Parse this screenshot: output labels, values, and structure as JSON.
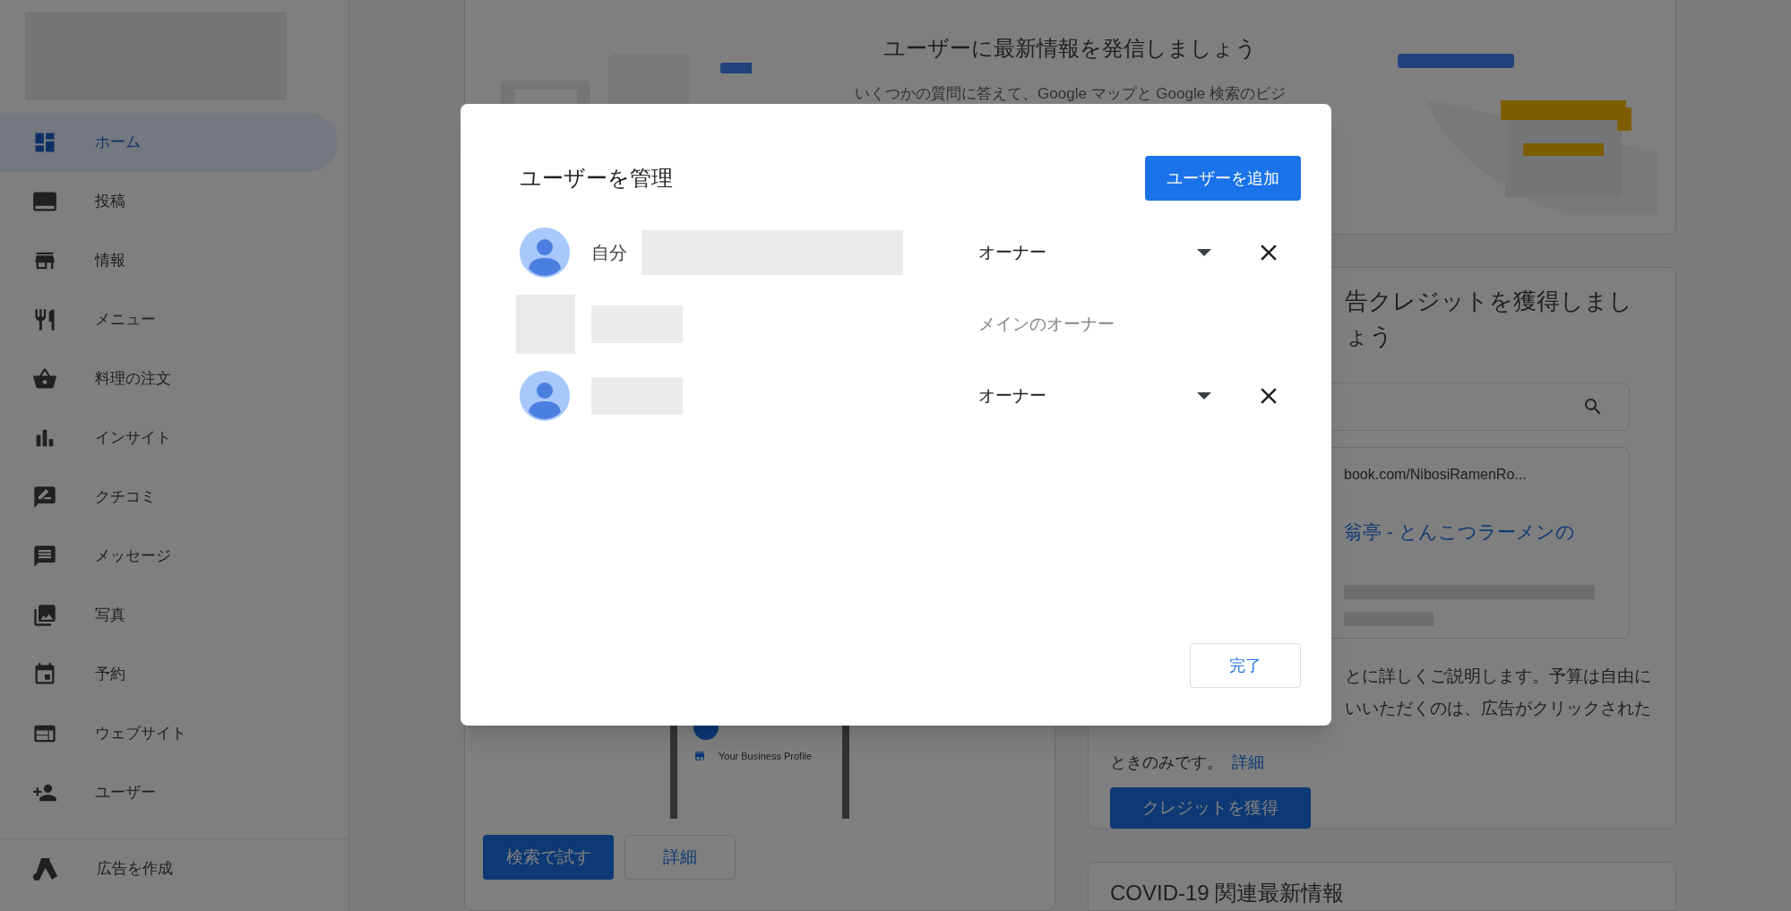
{
  "sidebar": {
    "items": [
      {
        "label": "ホーム",
        "selected": true
      },
      {
        "label": "投稿",
        "selected": false
      },
      {
        "label": "情報",
        "selected": false
      },
      {
        "label": "メニュー",
        "selected": false
      },
      {
        "label": "料理の注文",
        "selected": false
      },
      {
        "label": "インサイト",
        "selected": false
      },
      {
        "label": "クチコミ",
        "selected": false
      },
      {
        "label": "メッセージ",
        "selected": false
      },
      {
        "label": "写真",
        "selected": false
      },
      {
        "label": "予約",
        "selected": false
      },
      {
        "label": "ウェブサイト",
        "selected": false
      },
      {
        "label": "ユーザー",
        "selected": false
      }
    ],
    "footer_item": {
      "label": "広告を作成"
    }
  },
  "updates_card": {
    "title": "ユーザーに最新情報を発信しましょう",
    "description": "いくつかの質問に答えて、Google マップと Google 検索のビジ"
  },
  "try_card": {
    "preview_label": "Your Business Profile",
    "buttons": [
      {
        "label": "検索で試す",
        "kind": "primary"
      },
      {
        "label": "詳細",
        "kind": "outlined"
      }
    ]
  },
  "credit_card": {
    "title": "告クレジットを獲得しましょう",
    "ad_preview": {
      "url": "book.com/NibosiRamenRo...",
      "headline": "翁亭 - とんこつラーメンの"
    },
    "description_lines": [
      "とに詳しくご説明します。予算は自由に",
      "いいただくのは、広告がクリックされた"
    ],
    "description_end": "ときのみです。",
    "learn_more": "詳細",
    "button": "クレジットを獲得"
  },
  "covid_card": {
    "title": "COVID-19 関連最新情報"
  },
  "dialog": {
    "title": "ユーザーを管理",
    "add_button": "ユーザーを追加",
    "users": [
      {
        "kind": "editable",
        "self_label": "自分",
        "role": "オーナー"
      },
      {
        "kind": "fixed",
        "role": "メインのオーナー"
      },
      {
        "kind": "editable",
        "role": "オーナー"
      }
    ],
    "done_button": "完了"
  }
}
